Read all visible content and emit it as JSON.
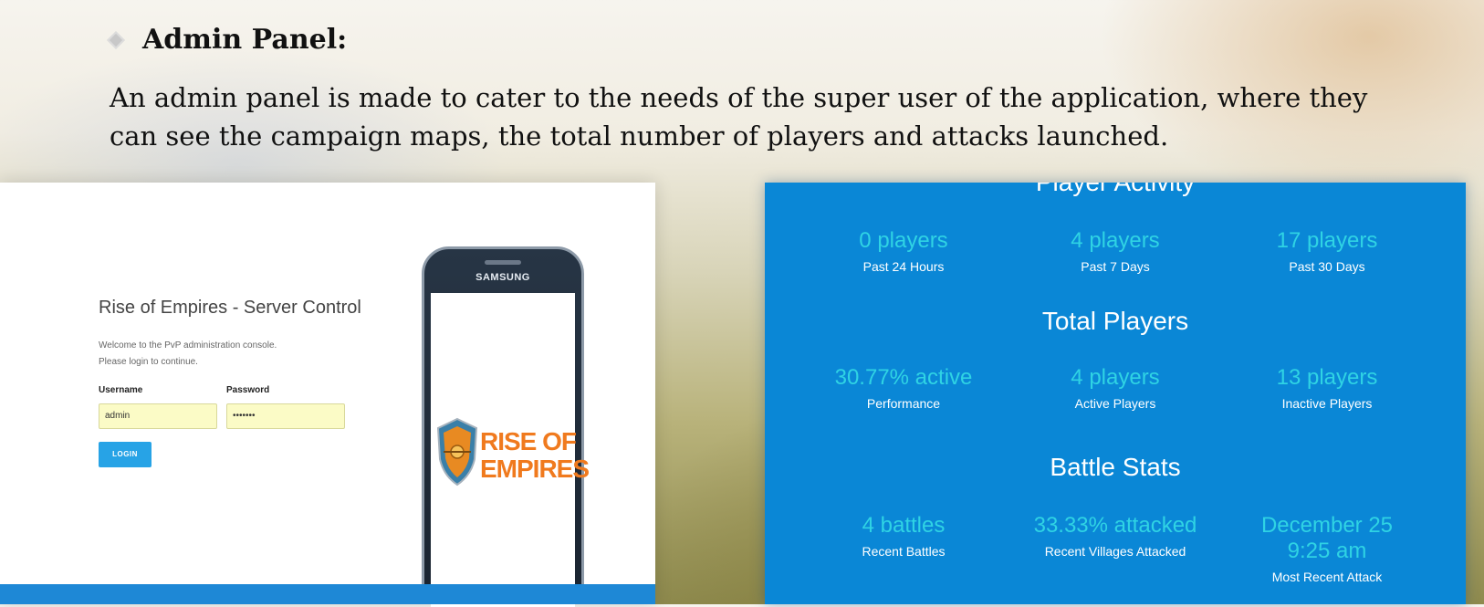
{
  "slide": {
    "heading": "Admin Panel:",
    "paragraph": "An admin panel is made to cater to the needs of the super user of the application, where they can see the campaign maps, the total number of players and attacks launched."
  },
  "login": {
    "title": "Rise of Empires - Server Control",
    "welcome_line1": "Welcome to the PvP administration console.",
    "welcome_line2": "Please login to continue.",
    "username_label": "Username",
    "username_value": "admin",
    "password_label": "Password",
    "password_value": "•••••••",
    "button_label": "LOGIN"
  },
  "phone": {
    "brand": "SAMSUNG",
    "logo_line1": "RISE OF",
    "logo_line2": "EMPIRES"
  },
  "stats": {
    "player_activity": {
      "title": "Player Activity",
      "items": [
        {
          "value": "0 players",
          "caption": "Past 24 Hours"
        },
        {
          "value": "4 players",
          "caption": "Past 7 Days"
        },
        {
          "value": "17 players",
          "caption": "Past 30 Days"
        }
      ]
    },
    "total_players": {
      "title": "Total Players",
      "items": [
        {
          "value": "30.77% active",
          "caption": "Performance"
        },
        {
          "value": "4 players",
          "caption": "Active Players"
        },
        {
          "value": "13 players",
          "caption": "Inactive Players"
        }
      ]
    },
    "battle_stats": {
      "title": "Battle Stats",
      "items": [
        {
          "value": "4 battles",
          "caption": "Recent Battles"
        },
        {
          "value": "33.33% attacked",
          "caption": "Recent Villages Attacked"
        },
        {
          "value_line1": "December 25",
          "value_line2": "9:25 am",
          "caption": "Most Recent Attack"
        }
      ]
    }
  },
  "colors": {
    "stats_background": "#0a87d6",
    "stat_value": "#2fd3e4",
    "login_button": "#27a3e6",
    "logo_orange": "#f07a1e",
    "input_background": "#fbfbc6"
  }
}
